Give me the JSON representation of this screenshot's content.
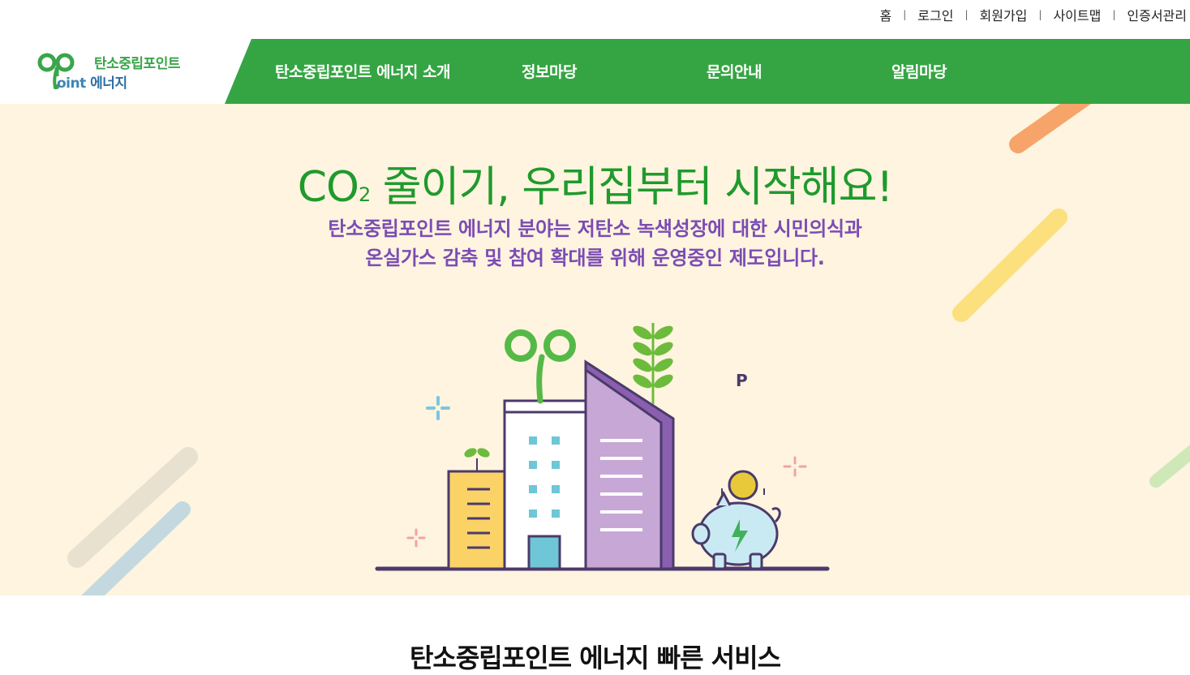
{
  "util_links": [
    "홈",
    "로그인",
    "회원가입",
    "사이트맵",
    "인증서관리"
  ],
  "logo": {
    "line1": "탄소중립포인트",
    "line2_prefix": "oint",
    "line2_suffix": "에너지"
  },
  "gnb": [
    "탄소중립포인트 에너지 소개",
    "정보마당",
    "문의안내",
    "알림마당"
  ],
  "hero": {
    "title_co": "CO",
    "title_sub": "2",
    "title_rest": " 줄이기, 우리집부터 시작해요!",
    "desc_line1": "탄소중립포인트 에너지 분야는 저탄소 녹색성장에 대한 시민의식과",
    "desc_line2": "온실가스 감축 및 참여 확대를 위해 운영중인 제도입니다.",
    "coin_letter": "P"
  },
  "quick_service_title": "탄소중립포인트 에너지 빠른 서비스",
  "colors": {
    "brand_green": "#35a543",
    "hero_bg": "#fef4df",
    "title_green": "#1f9a2d",
    "desc_purple": "#7b4cb4"
  }
}
